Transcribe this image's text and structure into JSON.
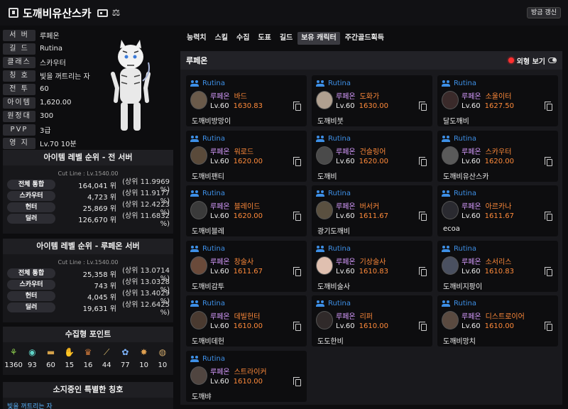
{
  "header": {
    "title": "도깨비유산스카",
    "refresh_label": "방금 갱신"
  },
  "profile": {
    "rows": [
      {
        "label": "서 버",
        "value": "루페온"
      },
      {
        "label": "길 드",
        "value": "Rutina"
      },
      {
        "label": "클래스",
        "value": "스카우터"
      },
      {
        "label": "칭 호",
        "value": "빛을 꺼트리는 자"
      },
      {
        "label": "전 투",
        "value": "60"
      },
      {
        "label": "아이템",
        "value": "1,620.00"
      },
      {
        "label": "원정대",
        "value": "300"
      },
      {
        "label": "PVP",
        "value": "3급"
      },
      {
        "label": "영 지",
        "value": "Lv.70 10분"
      }
    ]
  },
  "rank_all": {
    "title": "아이템 레벨 순위 - 전 서버",
    "cut_line": "Cut Line : Lv.1540.00",
    "rows": [
      {
        "label": "전체 통합",
        "value": "164,041 위",
        "pct": "(상위 11.9969 %)"
      },
      {
        "label": "스카우터",
        "value": "4,723 위",
        "pct": "(상위 11.9177 %)"
      },
      {
        "label": "헌터",
        "value": "25,869 위",
        "pct": "(상위 12.4223 %)"
      },
      {
        "label": "딜러",
        "value": "126,670 위",
        "pct": "(상위 11.6832 %)"
      }
    ]
  },
  "rank_server": {
    "title": "아이템 레벨 순위 - 루페온 서버",
    "cut_line": "Cut Line : Lv.1540.00",
    "rows": [
      {
        "label": "전체 통합",
        "value": "25,358 위",
        "pct": "(상위 13.0714 %)"
      },
      {
        "label": "스카우터",
        "value": "743 위",
        "pct": "(상위 13.0328 %)"
      },
      {
        "label": "헌터",
        "value": "4,045 위",
        "pct": "(상위 13.4029 %)"
      },
      {
        "label": "딜러",
        "value": "19,631 위",
        "pct": "(상위 12.6425 %)"
      }
    ]
  },
  "collection": {
    "title": "수집형 포인트",
    "items": [
      {
        "icon": "mokoko-seed-icon",
        "value": "1360",
        "color": "#8fd14f"
      },
      {
        "icon": "island-heart-icon",
        "value": "93",
        "color": "#5fd3c7"
      },
      {
        "icon": "great-art-icon",
        "value": "60",
        "color": "#d4a24a"
      },
      {
        "icon": "giant-heart-icon",
        "value": "15",
        "color": "#c9c9c9"
      },
      {
        "icon": "ignea-token-icon",
        "value": "16",
        "color": "#d27a3a"
      },
      {
        "icon": "orpheus-star-icon",
        "value": "44",
        "color": "#e0c070"
      },
      {
        "icon": "world-tree-leaf-icon",
        "value": "77",
        "color": "#7fb6ff"
      },
      {
        "icon": "sea-bounty-icon",
        "value": "10",
        "color": "#e0a050"
      },
      {
        "icon": "omnium-star-icon",
        "value": "10",
        "color": "#cfa86a"
      }
    ]
  },
  "titles": {
    "title": "소지중인 특별한 칭호",
    "first": "빛을 꺼트리는 자"
  },
  "tabs": [
    {
      "label": "능력치",
      "active": false
    },
    {
      "label": "스킬",
      "active": false
    },
    {
      "label": "수집",
      "active": false
    },
    {
      "label": "도표",
      "active": false
    },
    {
      "label": "길드",
      "active": false
    },
    {
      "label": "보유 캐릭터",
      "active": true
    },
    {
      "label": "주간골드획득",
      "active": false
    }
  ],
  "panel": {
    "server": "루페온",
    "appearance_label": "외형 보기"
  },
  "characters": [
    {
      "guild": "Rutina",
      "server": "루페온",
      "class": "바드",
      "level": "Lv.60",
      "ilvl": "1630.83",
      "nick": "도깨비방망이"
    },
    {
      "guild": "Rutina",
      "server": "루페온",
      "class": "도화가",
      "level": "Lv.60",
      "ilvl": "1630.00",
      "nick": "도깨비붓"
    },
    {
      "guild": "Rutina",
      "server": "루페온",
      "class": "소울이터",
      "level": "Lv.60",
      "ilvl": "1627.50",
      "nick": "달도깨비"
    },
    {
      "guild": "Rutina",
      "server": "루페온",
      "class": "워로드",
      "level": "Lv.60",
      "ilvl": "1620.00",
      "nick": "도깨비팬티"
    },
    {
      "guild": "Rutina",
      "server": "루페온",
      "class": "건슬링어",
      "level": "Lv.60",
      "ilvl": "1620.00",
      "nick": "도깨비"
    },
    {
      "guild": "Rutina",
      "server": "루페온",
      "class": "스카우터",
      "level": "Lv.60",
      "ilvl": "1620.00",
      "nick": "도깨비유산스카"
    },
    {
      "guild": "Rutina",
      "server": "루페온",
      "class": "블레이드",
      "level": "Lv.60",
      "ilvl": "1620.00",
      "nick": "도깨비블레"
    },
    {
      "guild": "Rutina",
      "server": "루페온",
      "class": "버서커",
      "level": "Lv.60",
      "ilvl": "1611.67",
      "nick": "광기도깨비"
    },
    {
      "guild": "Rutina",
      "server": "루페온",
      "class": "아르카나",
      "level": "Lv.60",
      "ilvl": "1611.67",
      "nick": "ecoa"
    },
    {
      "guild": "Rutina",
      "server": "루페온",
      "class": "창술사",
      "level": "Lv.60",
      "ilvl": "1611.67",
      "nick": "도깨비감투"
    },
    {
      "guild": "Rutina",
      "server": "루페온",
      "class": "기상술사",
      "level": "Lv.60",
      "ilvl": "1610.83",
      "nick": "도깨비술사"
    },
    {
      "guild": "Rutina",
      "server": "루페온",
      "class": "소서리스",
      "level": "Lv.60",
      "ilvl": "1610.83",
      "nick": "도깨비지팡이"
    },
    {
      "guild": "Rutina",
      "server": "루페온",
      "class": "데빌헌터",
      "level": "Lv.60",
      "ilvl": "1610.00",
      "nick": "도깨비데헌"
    },
    {
      "guild": "Rutina",
      "server": "루페온",
      "class": "리퍼",
      "level": "Lv.60",
      "ilvl": "1610.00",
      "nick": "도도한비"
    },
    {
      "guild": "Rutina",
      "server": "루페온",
      "class": "디스트로이어",
      "level": "Lv.60",
      "ilvl": "1610.00",
      "nick": "도깨비망치"
    },
    {
      "guild": "Rutina",
      "server": "루페온",
      "class": "스트라이커",
      "level": "Lv.60",
      "ilvl": "1610.00",
      "nick": "도깨뱌"
    }
  ]
}
